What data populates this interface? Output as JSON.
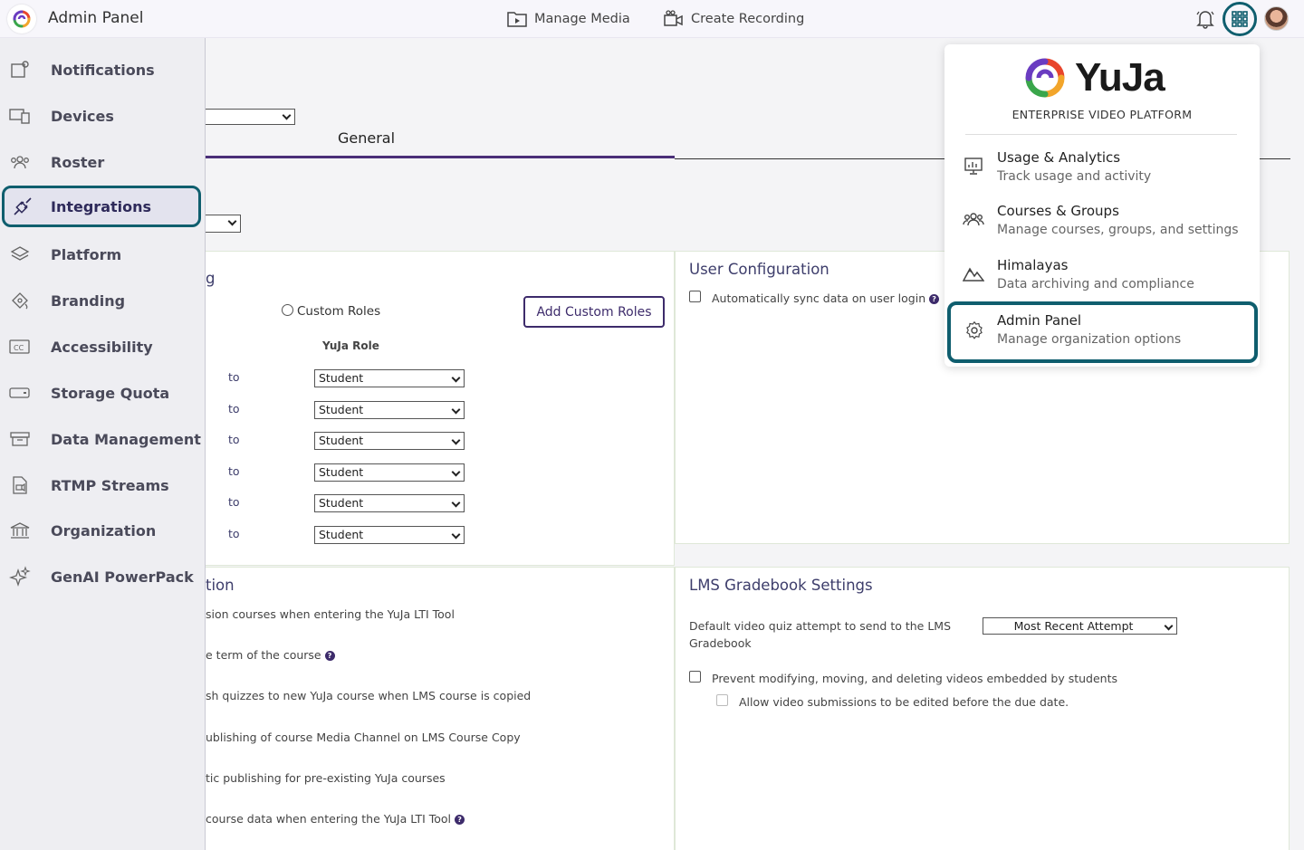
{
  "header": {
    "title": "Admin Panel",
    "manage_media": "Manage Media",
    "create_recording": "Create Recording"
  },
  "sidebar": {
    "items": [
      {
        "label": "Notifications",
        "icon": "notifications-icon"
      },
      {
        "label": "Devices",
        "icon": "devices-icon"
      },
      {
        "label": "Roster",
        "icon": "roster-icon"
      },
      {
        "label": "Integrations",
        "icon": "integrations-icon",
        "active": true
      },
      {
        "label": "Platform",
        "icon": "platform-icon"
      },
      {
        "label": "Branding",
        "icon": "branding-icon"
      },
      {
        "label": "Accessibility",
        "icon": "accessibility-icon"
      },
      {
        "label": "Storage Quota",
        "icon": "storage-icon"
      },
      {
        "label": "Data Management",
        "icon": "data-management-icon"
      },
      {
        "label": "RTMP Streams",
        "icon": "rtmp-icon"
      },
      {
        "label": "Organization",
        "icon": "organization-icon"
      },
      {
        "label": "GenAI PowerPack",
        "icon": "sparkle-icon"
      }
    ]
  },
  "main": {
    "tab_general": "General",
    "role_panel": {
      "title_fragment": "g",
      "custom_roles_option": "Custom Roles",
      "add_custom_roles": "Add Custom Roles",
      "yuja_role_header": "YuJa Role",
      "to_label": "to",
      "rows": [
        "Student",
        "Student",
        "Student",
        "Student",
        "Student",
        "Student"
      ]
    },
    "user_config": {
      "title": "User Configuration",
      "auto_sync": "Automatically sync data on user login"
    },
    "course_panel": {
      "title_fragment": "tion",
      "lines": [
        "sion courses when entering the YuJa LTI Tool",
        "e term of the course",
        "sh quizzes to new YuJa course when LMS course is copied",
        "ublishing of course Media Channel on LMS Course Copy",
        "tic publishing for pre-existing YuJa courses",
        "course data when entering the YuJa LTI Tool"
      ]
    },
    "gradebook": {
      "title": "LMS Gradebook Settings",
      "attempt_label_1": "Default video quiz attempt to send to the LMS",
      "attempt_label_2": "Gradebook",
      "attempt_value": "Most Recent Attempt",
      "prevent_label": "Prevent modifying, moving, and deleting videos embedded by students",
      "allow_label": "Allow video submissions to be edited before the due date."
    }
  },
  "dropdown": {
    "logo_text": "YuJa",
    "subtitle": "ENTERPRISE VIDEO PLATFORM",
    "items": [
      {
        "title": "Usage & Analytics",
        "desc": "Track usage and activity"
      },
      {
        "title": "Courses & Groups",
        "desc": "Manage courses, groups, and settings"
      },
      {
        "title": "Himalayas",
        "desc": "Data archiving and compliance"
      },
      {
        "title": "Admin Panel",
        "desc": "Manage organization options"
      }
    ]
  },
  "colors": {
    "accent": "#0f5e6e",
    "brand_purple": "#3d2b6b"
  }
}
